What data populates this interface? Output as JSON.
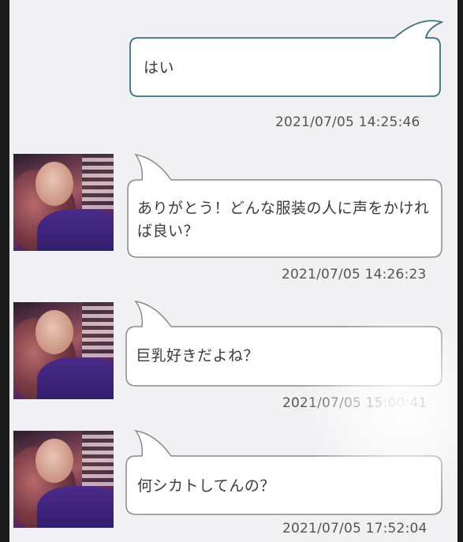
{
  "messages": [
    {
      "side": "sent",
      "text": "はい",
      "time": "2021/07/05 14:25:46"
    },
    {
      "side": "received",
      "text": "ありがとう！どんな服装の人に声をかければ良い？",
      "time": "2021/07/05 14:26:23"
    },
    {
      "side": "received",
      "text": "巨乳好きだよね？",
      "time": "2021/07/05 15:00:41"
    },
    {
      "side": "received",
      "text": "何シカトしてんの？",
      "time": "2021/07/05 17:52:04"
    }
  ],
  "colors": {
    "sent_border": "#3d6f84",
    "received_border": "#8a8a8a",
    "bubble_fill": "#ffffff",
    "screen_bg": "#f1f1f4"
  },
  "icons": {
    "avatar": "profile-photo"
  }
}
